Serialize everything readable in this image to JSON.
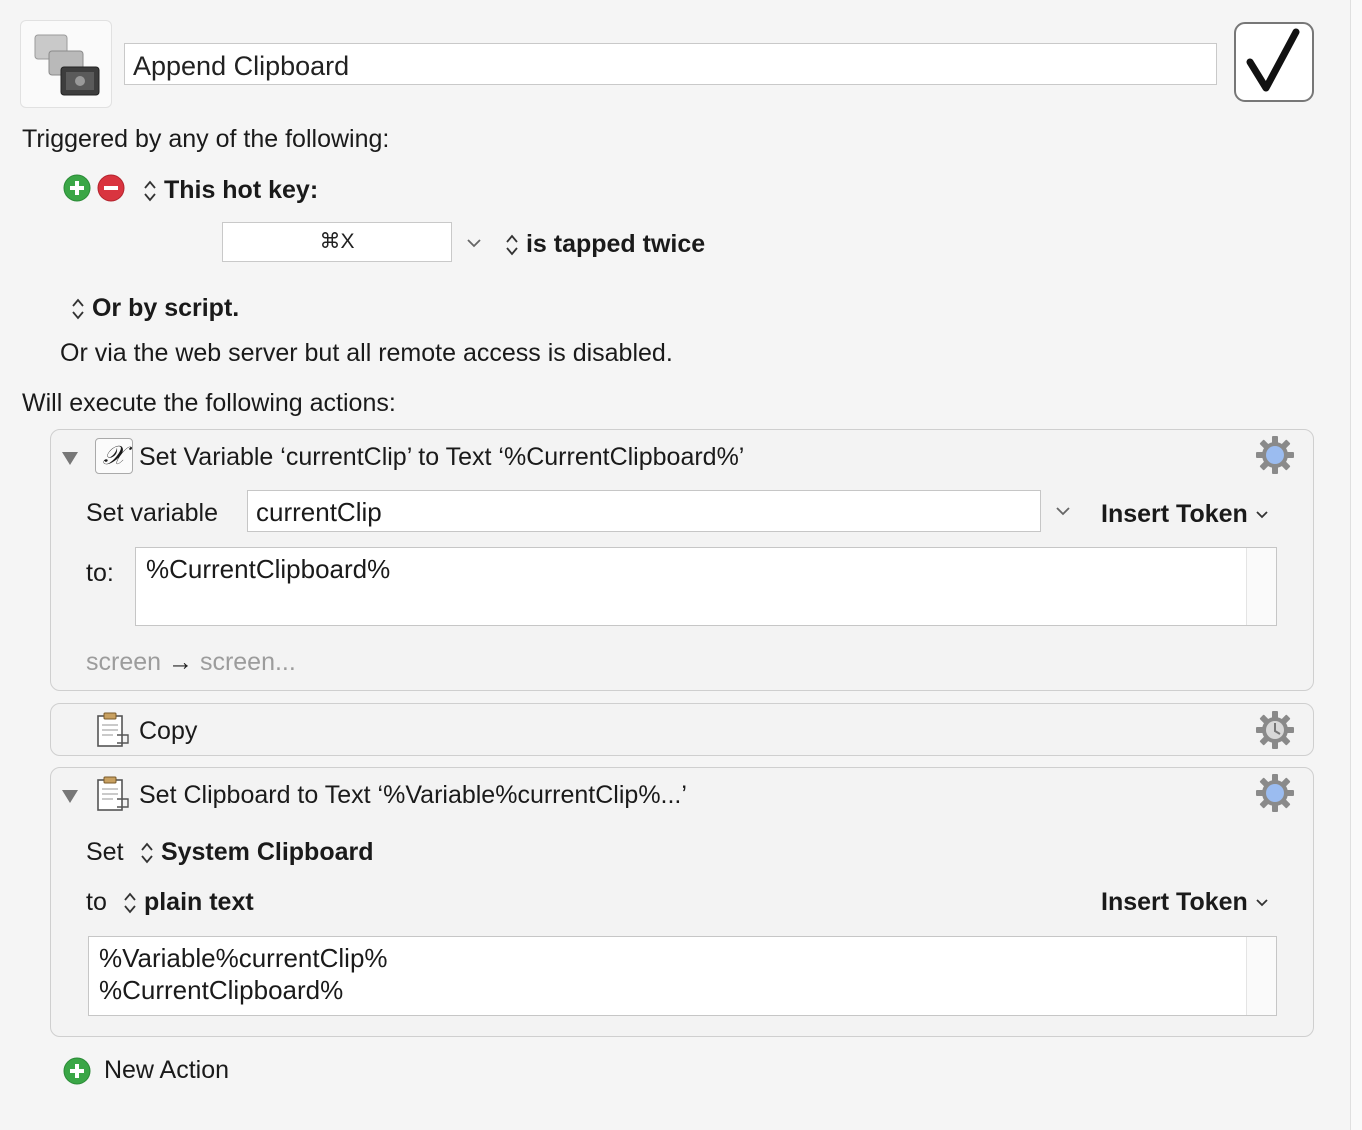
{
  "macro": {
    "name": "Append Clipboard",
    "enabled": true
  },
  "triggers": {
    "heading": "Triggered by any of the following:",
    "hotkey_label": "This hot key:",
    "hotkey_value": "⌘X",
    "hotkey_mode": "is tapped twice",
    "script_label": "Or by script.",
    "web_server_note": "Or via the web server but all remote access is disabled."
  },
  "actions_heading": "Will execute the following actions:",
  "actions": [
    {
      "title": "Set Variable ‘currentClip’ to Text ‘%CurrentClipboard%’",
      "set_variable_label": "Set variable",
      "variable_name": "currentClip",
      "insert_token": "Insert Token",
      "to_label": "to:",
      "text_value": "%CurrentClipboard%",
      "display_from": "screen",
      "display_arrow": "→",
      "display_to": "screen..."
    },
    {
      "title": "Copy"
    },
    {
      "title": "Set Clipboard to Text ‘%Variable%currentClip%...’",
      "set_label": "Set",
      "clipboard": "System Clipboard",
      "to_label": "to",
      "format": "plain text",
      "insert_token": "Insert Token",
      "text_line1": "%Variable%currentClip%",
      "text_line2": "%CurrentClipboard%"
    }
  ],
  "new_action": "New Action",
  "colors": {
    "add_green": "#3aa646",
    "remove_red": "#d9343f",
    "gear_blue": "#9bbcf0"
  }
}
